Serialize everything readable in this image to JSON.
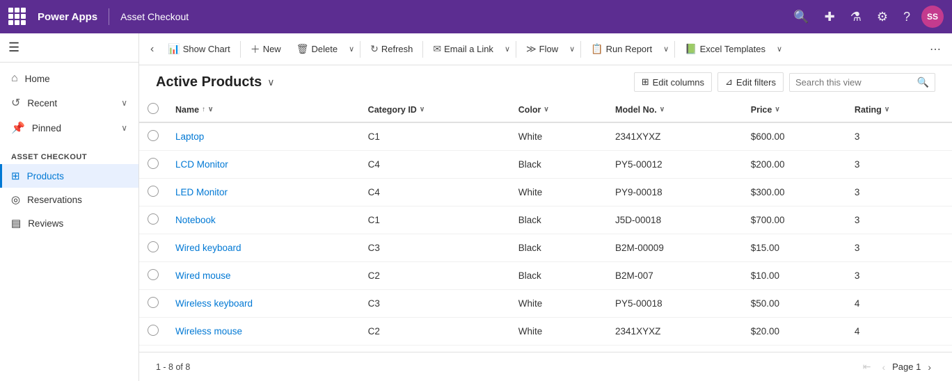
{
  "topbar": {
    "brand": "Power Apps",
    "appname": "Asset Checkout",
    "avatar_initials": "SS",
    "icons": [
      "search",
      "add",
      "filter",
      "settings",
      "help"
    ]
  },
  "sidebar": {
    "nav_items": [
      {
        "id": "home",
        "label": "Home",
        "icon": "⌂"
      },
      {
        "id": "recent",
        "label": "Recent",
        "icon": "↺",
        "has_chevron": true
      },
      {
        "id": "pinned",
        "label": "Pinned",
        "icon": "📌",
        "has_chevron": true
      }
    ],
    "section_label": "Asset Checkout",
    "app_items": [
      {
        "id": "products",
        "label": "Products",
        "icon": "⊞",
        "active": true
      },
      {
        "id": "reservations",
        "label": "Reservations",
        "icon": "◎",
        "active": false
      },
      {
        "id": "reviews",
        "label": "Reviews",
        "icon": "▤",
        "active": false
      }
    ]
  },
  "command_bar": {
    "back_icon": "‹",
    "show_chart_label": "Show Chart",
    "new_label": "New",
    "delete_label": "Delete",
    "refresh_label": "Refresh",
    "email_link_label": "Email a Link",
    "flow_label": "Flow",
    "run_report_label": "Run Report",
    "excel_templates_label": "Excel Templates"
  },
  "view": {
    "title": "Active Products",
    "edit_columns_label": "Edit columns",
    "edit_filters_label": "Edit filters",
    "search_placeholder": "Search this view"
  },
  "table": {
    "columns": [
      {
        "id": "name",
        "label": "Name",
        "sortable": true,
        "sort_dir": "asc"
      },
      {
        "id": "category_id",
        "label": "Category ID",
        "sortable": true
      },
      {
        "id": "color",
        "label": "Color",
        "sortable": true
      },
      {
        "id": "model_no",
        "label": "Model No.",
        "sortable": true
      },
      {
        "id": "price",
        "label": "Price",
        "sortable": true
      },
      {
        "id": "rating",
        "label": "Rating",
        "sortable": true
      }
    ],
    "rows": [
      {
        "name": "Laptop",
        "category_id": "C1",
        "color": "White",
        "model_no": "2341XYXZ",
        "price": "$600.00",
        "rating": "3"
      },
      {
        "name": "LCD Monitor",
        "category_id": "C4",
        "color": "Black",
        "model_no": "PY5-00012",
        "price": "$200.00",
        "rating": "3"
      },
      {
        "name": "LED Monitor",
        "category_id": "C4",
        "color": "White",
        "model_no": "PY9-00018",
        "price": "$300.00",
        "rating": "3"
      },
      {
        "name": "Notebook",
        "category_id": "C1",
        "color": "Black",
        "model_no": "J5D-00018",
        "price": "$700.00",
        "rating": "3"
      },
      {
        "name": "Wired keyboard",
        "category_id": "C3",
        "color": "Black",
        "model_no": "B2M-00009",
        "price": "$15.00",
        "rating": "3"
      },
      {
        "name": "Wired mouse",
        "category_id": "C2",
        "color": "Black",
        "model_no": "B2M-007",
        "price": "$10.00",
        "rating": "3"
      },
      {
        "name": "Wireless keyboard",
        "category_id": "C3",
        "color": "White",
        "model_no": "PY5-00018",
        "price": "$50.00",
        "rating": "4"
      },
      {
        "name": "Wireless mouse",
        "category_id": "C2",
        "color": "White",
        "model_no": "2341XYXZ",
        "price": "$20.00",
        "rating": "4"
      }
    ]
  },
  "footer": {
    "record_count": "1 - 8 of 8",
    "page_label": "Page 1"
  }
}
